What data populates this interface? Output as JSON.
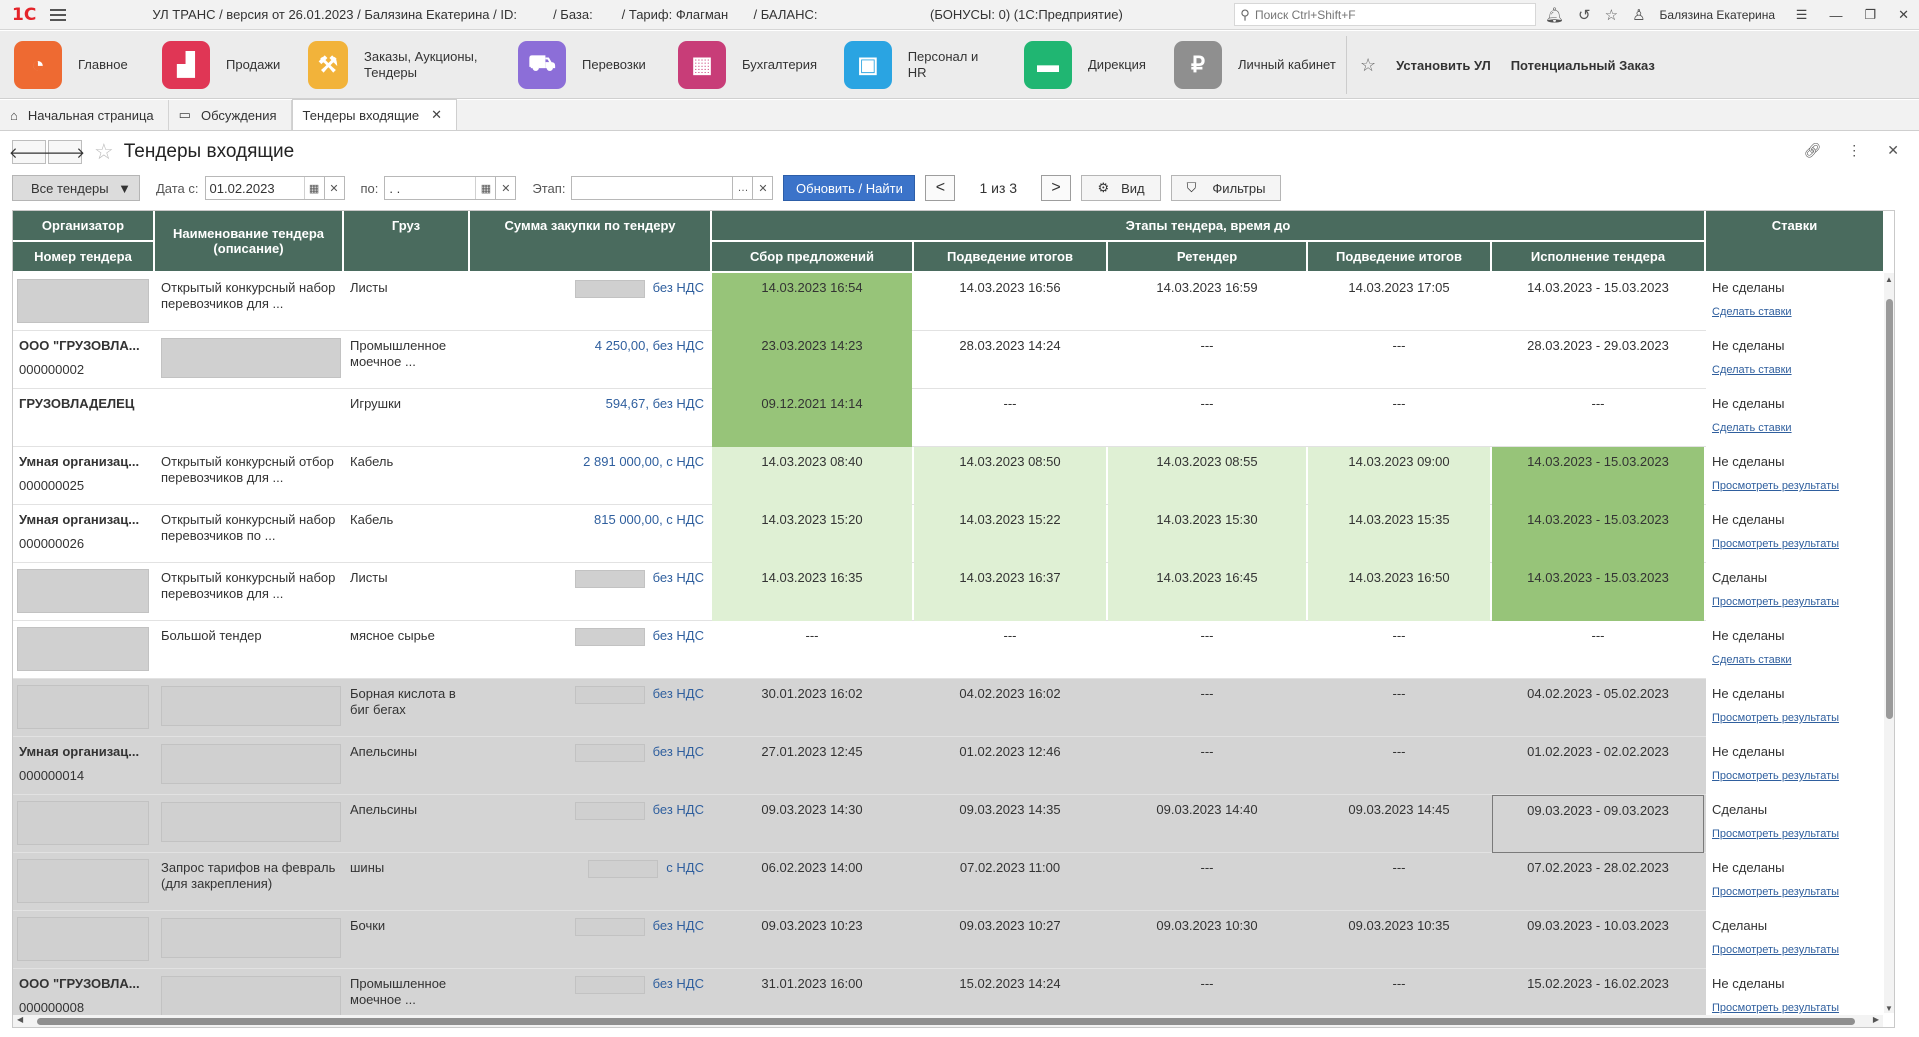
{
  "titlebar": {
    "logo": "1С",
    "title": "УЛ ТРАНС / версия от 26.01.2023 / Балязина Екатерина / ID:          / База:        / Тариф: Флагман       / БАЛАНС:",
    "bonus": "(БОНУСЫ: 0)  (1С:Предприятие)",
    "search_placeholder": "Поиск Ctrl+Shift+F",
    "user": "Балязина Екатерина"
  },
  "sections": [
    {
      "label": "Главное",
      "color": "#ee6a32",
      "icon": "main-section-icon",
      "glyph": "◔"
    },
    {
      "label": "Продажи",
      "color": "#e03655",
      "icon": "sales-chart-icon",
      "glyph": "▟"
    },
    {
      "label": "Заказы, Аукционы, Тендеры",
      "color": "#f2b33a",
      "icon": "auction-hammer-icon",
      "glyph": "⚒"
    },
    {
      "label": "Перевозки",
      "color": "#8c6ed8",
      "icon": "truck-icon",
      "glyph": "⛟"
    },
    {
      "label": "Бухгалтерия",
      "color": "#c83d78",
      "icon": "calculator-icon",
      "glyph": "▦"
    },
    {
      "label": "Персонал и HR",
      "color": "#2aa4e2",
      "icon": "badge-icon",
      "glyph": "▣"
    },
    {
      "label": "Дирекция",
      "color": "#20b672",
      "icon": "briefcase-icon",
      "glyph": "▬"
    },
    {
      "label": "Личный кабинет",
      "color": "#8f8f8f",
      "icon": "lock-icon",
      "glyph": "₽"
    }
  ],
  "sections_right": {
    "install": "Установить УЛ",
    "potential": "Потенциальный Заказ"
  },
  "tabs": [
    {
      "label": "Начальная страница"
    },
    {
      "label": "Обсуждения"
    },
    {
      "label": "Тендеры входящие"
    }
  ],
  "form": {
    "title": "Тендеры входящие"
  },
  "toolbar": {
    "filter_select": "Все тендеры",
    "date_from_label": "Дата с:",
    "date_from": "01.02.2023",
    "date_to_label": "по:",
    "date_to": " .  .",
    "stage_label": "Этап:",
    "refresh": "Обновить / Найти",
    "pager": "1 из 3",
    "view": "Вид",
    "filters": "Фильтры"
  },
  "columns": {
    "organizer": "Организатор",
    "tender_number": "Номер тендера",
    "tender_name": "Наименование тендера (описание)",
    "cargo": "Груз",
    "sum": "Сумма закупки по тендеру",
    "stages": "Этапы тендера, время до",
    "stage_collect": "Сбор предложений",
    "stage_results1": "Подведение итогов",
    "stage_retender": "Ретендер",
    "stage_results2": "Подведение итогов",
    "stage_exec": "Исполнение тендера",
    "bids": "Ставки"
  },
  "rows": [
    {
      "org": "",
      "num": "",
      "name": "Открытый конкурсный набор перевозчиков для ...",
      "cargo": "Листы",
      "sum": "без НДС",
      "s1": "14.03.2023 16:54",
      "s2": "14.03.2023 16:56",
      "s3": "14.03.2023 16:59",
      "s4": "14.03.2023 17:05",
      "s5": "14.03.2023 - 15.03.2023",
      "bid": "Не сделаны",
      "action": "Сделать ставки"
    },
    {
      "org": "ООО \"ГРУЗОВЛА...",
      "num": "000000002",
      "name": "",
      "cargo": "Промышленное моечное ...",
      "sum": "4 250,00, без НДС",
      "s1": "23.03.2023 14:23",
      "s2": "28.03.2023 14:24",
      "s3": "---",
      "s4": "---",
      "s5": "28.03.2023 - 29.03.2023",
      "bid": "Не сделаны",
      "action": "Сделать ставки"
    },
    {
      "org": "ГРУЗОВЛАДЕЛЕЦ",
      "num": "",
      "name": "",
      "cargo": "Игрушки",
      "sum": "594,67, без НДС",
      "s1": "09.12.2021 14:14",
      "s2": "---",
      "s3": "---",
      "s4": "---",
      "s5": "---",
      "bid": "Не сделаны",
      "action": "Сделать ставки"
    },
    {
      "org": "Умная организац...",
      "num": "000000025",
      "name": "Открытый конкурсный отбор перевозчиков для ...",
      "cargo": "Кабель",
      "sum": "2 891 000,00, с НДС",
      "s1": "14.03.2023 08:40",
      "s2": "14.03.2023 08:50",
      "s3": "14.03.2023 08:55",
      "s4": "14.03.2023 09:00",
      "s5": "14.03.2023 - 15.03.2023",
      "bid": "Не сделаны",
      "action": "Просмотреть результаты"
    },
    {
      "org": "Умная организац...",
      "num": "000000026",
      "name": "Открытый конкурсный набор перевозчиков по ...",
      "cargo": "Кабель",
      "sum": "815 000,00, с НДС",
      "s1": "14.03.2023 15:20",
      "s2": "14.03.2023 15:22",
      "s3": "14.03.2023 15:30",
      "s4": "14.03.2023 15:35",
      "s5": "14.03.2023 - 15.03.2023",
      "bid": "Не сделаны",
      "action": "Просмотреть результаты"
    },
    {
      "org": "",
      "num": "",
      "name": "Открытый конкурсный набор перевозчиков для ...",
      "cargo": "Листы",
      "sum": "без НДС",
      "s1": "14.03.2023 16:35",
      "s2": "14.03.2023 16:37",
      "s3": "14.03.2023 16:45",
      "s4": "14.03.2023 16:50",
      "s5": "14.03.2023 - 15.03.2023",
      "bid": "Сделаны",
      "action": "Просмотреть результаты"
    },
    {
      "org": "",
      "num": "",
      "name": "Большой тендер",
      "cargo": "мясное сырье",
      "sum": "без НДС",
      "s1": "---",
      "s2": "---",
      "s3": "---",
      "s4": "---",
      "s5": "---",
      "bid": "Не сделаны",
      "action": "Сделать ставки"
    },
    {
      "org": "",
      "num": "",
      "name": "",
      "cargo": "Борная кислота в биг бегах",
      "sum": "без НДС",
      "s1": "30.01.2023 16:02",
      "s2": "04.02.2023 16:02",
      "s3": "---",
      "s4": "---",
      "s5": "04.02.2023 - 05.02.2023",
      "bid": "Не сделаны",
      "action": "Просмотреть результаты"
    },
    {
      "org": "Умная организац...",
      "num": "000000014",
      "name": "",
      "cargo": "Апельсины",
      "sum": "без НДС",
      "s1": "27.01.2023 12:45",
      "s2": "01.02.2023 12:46",
      "s3": "---",
      "s4": "---",
      "s5": "01.02.2023 - 02.02.2023",
      "bid": "Не сделаны",
      "action": "Просмотреть результаты"
    },
    {
      "org": "",
      "num": "",
      "name": "",
      "cargo": "Апельсины",
      "sum": "без НДС",
      "s1": "09.03.2023 14:30",
      "s2": "09.03.2023 14:35",
      "s3": "09.03.2023 14:40",
      "s4": "09.03.2023 14:45",
      "s5": "09.03.2023 - 09.03.2023",
      "bid": "Сделаны",
      "action": "Просмотреть результаты"
    },
    {
      "org": "",
      "num": "",
      "name": "Запрос тарифов на февраль (для закрепления)",
      "cargo": "шины",
      "sum": "с НДС",
      "s1": "06.02.2023 14:00",
      "s2": "07.02.2023 11:00",
      "s3": "---",
      "s4": "---",
      "s5": "07.02.2023 - 28.02.2023",
      "bid": "Не сделаны",
      "action": "Просмотреть результаты"
    },
    {
      "org": "",
      "num": "",
      "name": "",
      "cargo": "Бочки",
      "sum": "без НДС",
      "s1": "09.03.2023 10:23",
      "s2": "09.03.2023 10:27",
      "s3": "09.03.2023 10:30",
      "s4": "09.03.2023 10:35",
      "s5": "09.03.2023 - 10.03.2023",
      "bid": "Сделаны",
      "action": "Просмотреть результаты"
    },
    {
      "org": "ООО \"ГРУЗОВЛА...",
      "num": "000000008",
      "name": "",
      "cargo": "Промышленное моечное ...",
      "sum": "без НДС",
      "s1": "31.01.2023 16:00",
      "s2": "15.02.2023 14:24",
      "s3": "---",
      "s4": "---",
      "s5": "15.02.2023 - 16.02.2023",
      "bid": "Не сделаны",
      "action": "Просмотреть результаты"
    }
  ],
  "colors": {
    "header": "#4a6b5e",
    "green": "#97c479",
    "light_green": "#dff0d4",
    "closed_gray": "#d4d4d4",
    "link": "#2f5f9e",
    "primary": "#3b73c9"
  }
}
